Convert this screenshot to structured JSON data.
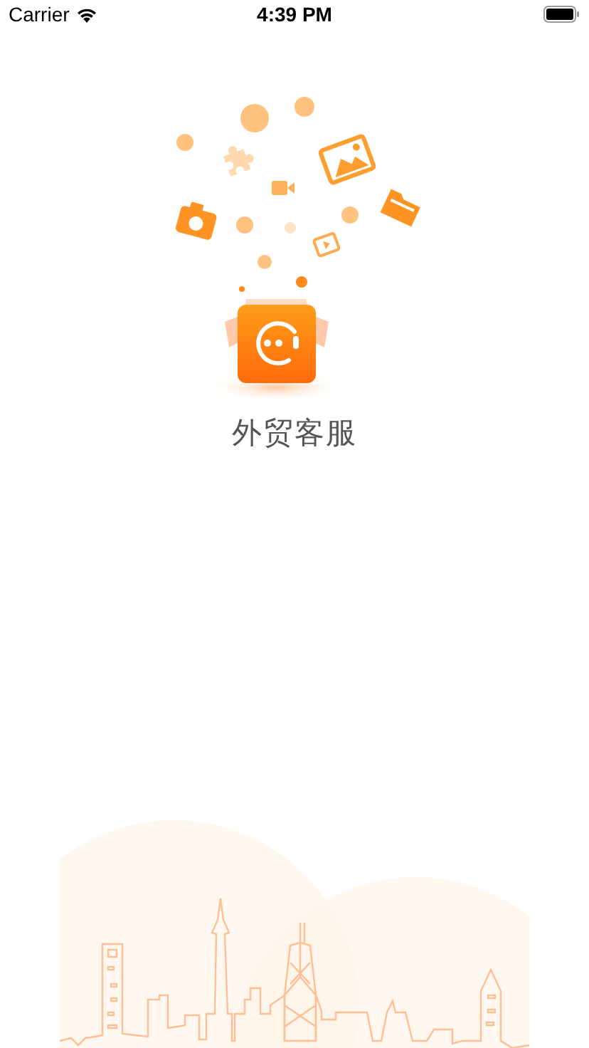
{
  "status_bar": {
    "carrier": "Carrier",
    "time": "4:39 PM"
  },
  "app_name": "外贸客服"
}
